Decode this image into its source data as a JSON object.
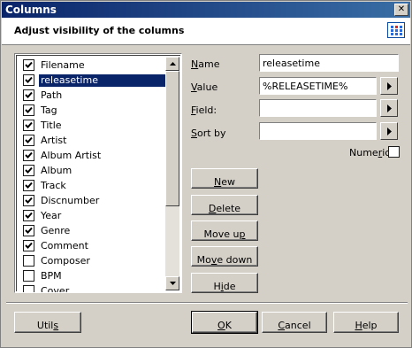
{
  "window": {
    "title": "Columns",
    "close_glyph": "✕"
  },
  "header": {
    "title": "Adjust visibility of the columns",
    "icon": "columns-grid-icon"
  },
  "columns": {
    "items": [
      {
        "label": "Filename",
        "checked": true,
        "selected": false
      },
      {
        "label": "releasetime",
        "checked": true,
        "selected": true
      },
      {
        "label": "Path",
        "checked": true,
        "selected": false
      },
      {
        "label": "Tag",
        "checked": true,
        "selected": false
      },
      {
        "label": "Title",
        "checked": true,
        "selected": false
      },
      {
        "label": "Artist",
        "checked": true,
        "selected": false
      },
      {
        "label": "Album Artist",
        "checked": true,
        "selected": false
      },
      {
        "label": "Album",
        "checked": true,
        "selected": false
      },
      {
        "label": "Track",
        "checked": true,
        "selected": false
      },
      {
        "label": "Discnumber",
        "checked": true,
        "selected": false
      },
      {
        "label": "Year",
        "checked": true,
        "selected": false
      },
      {
        "label": "Genre",
        "checked": true,
        "selected": false
      },
      {
        "label": "Comment",
        "checked": true,
        "selected": false
      },
      {
        "label": "Composer",
        "checked": false,
        "selected": false
      },
      {
        "label": "BPM",
        "checked": false,
        "selected": false
      },
      {
        "label": "Cover",
        "checked": false,
        "selected": false
      }
    ]
  },
  "form": {
    "name_label": {
      "u": "N",
      "rest": "ame"
    },
    "name_value": "releasetime",
    "value_label": {
      "u": "V",
      "rest": "alue"
    },
    "value_value": "%RELEASETIME%",
    "field_label": {
      "u": "F",
      "rest": "ield:"
    },
    "field_value": "",
    "sortby_label": {
      "u": "S",
      "rest": "ort by"
    },
    "sortby_value": "",
    "numeric_label": {
      "pre": "Nume",
      "u": "r",
      "post": "ic"
    },
    "numeric_checked": false
  },
  "actions": {
    "new": {
      "u": "N",
      "rest": "ew"
    },
    "delete": {
      "u": "D",
      "rest": "elete"
    },
    "move_up": {
      "pre": "Move u",
      "u": "p"
    },
    "move_down": {
      "pre": "Mo",
      "u": "v",
      "post": "e down"
    },
    "hide": {
      "pre": "H",
      "u": "i",
      "post": "de"
    }
  },
  "footer": {
    "utils": {
      "pre": "Util",
      "u": "s"
    },
    "ok": {
      "u": "O",
      "rest": "K"
    },
    "cancel": {
      "u": "C",
      "rest": "ancel"
    },
    "help": {
      "u": "H",
      "rest": "elp"
    }
  },
  "colors": {
    "selection": "#0a246a",
    "face": "#d4d0c8"
  }
}
